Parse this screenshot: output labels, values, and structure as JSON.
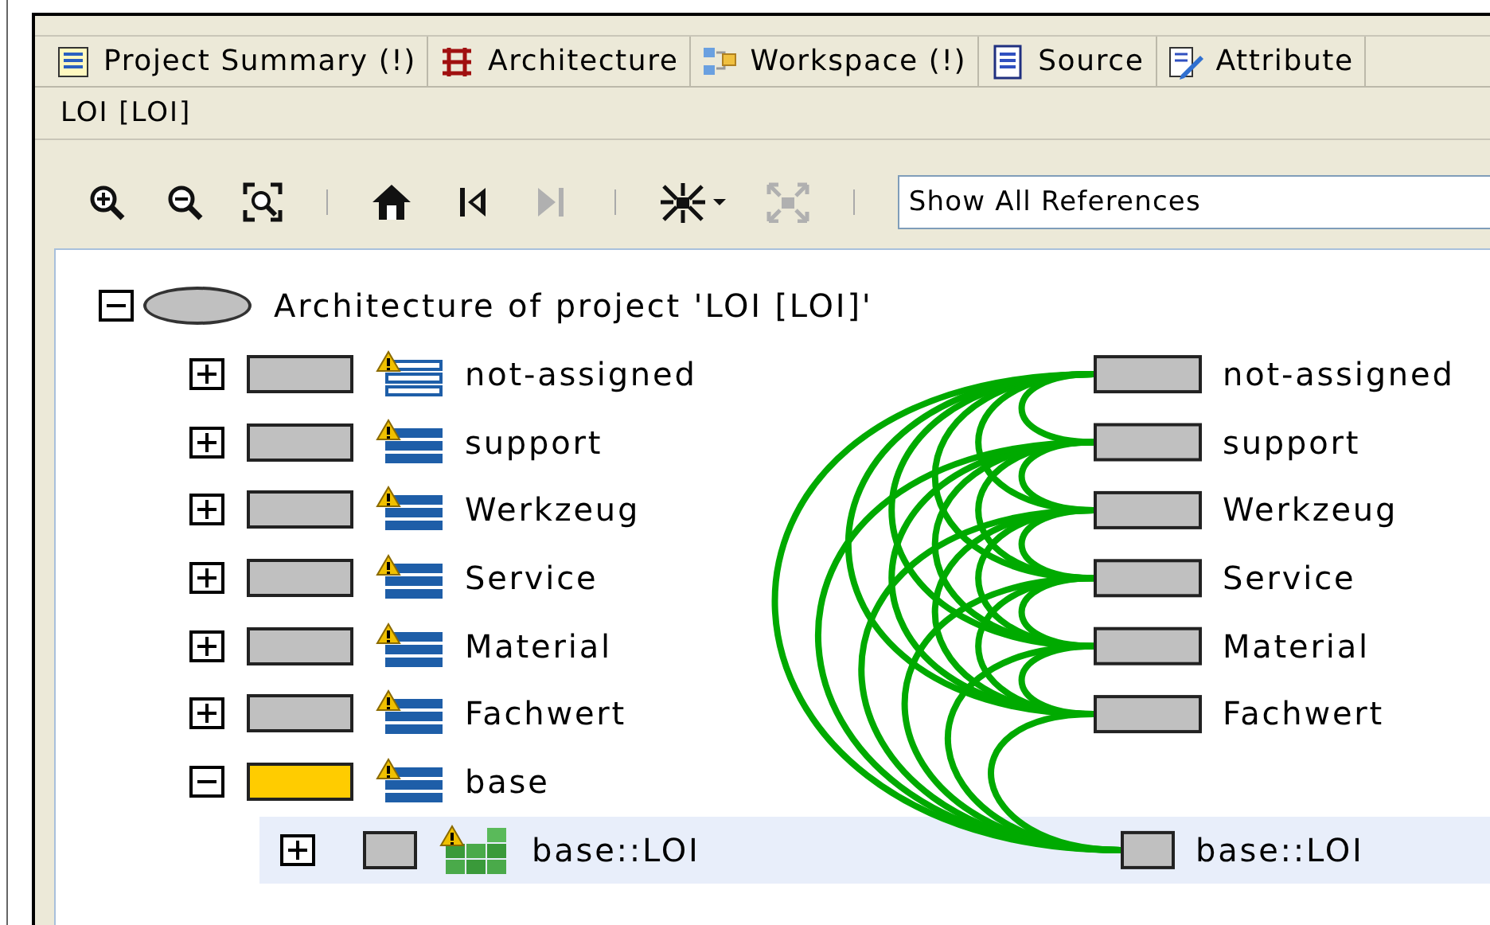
{
  "tabs": [
    {
      "label": "Project Summary (!)",
      "kind": "summary"
    },
    {
      "label": "Architecture",
      "kind": "architecture"
    },
    {
      "label": "Workspace (!)",
      "kind": "workspace"
    },
    {
      "label": "Source",
      "kind": "source"
    },
    {
      "label": "Attribute",
      "kind": "attribute"
    }
  ],
  "breadcrumb": "LOI [LOI]",
  "toolbar": [
    {
      "kind": "zoom-in",
      "disabled": false
    },
    {
      "kind": "zoom-out",
      "disabled": false
    },
    {
      "kind": "zoom-fit",
      "disabled": false
    },
    {
      "kind": "separator"
    },
    {
      "kind": "home",
      "disabled": false
    },
    {
      "kind": "first",
      "disabled": false
    },
    {
      "kind": "next",
      "disabled": true
    },
    {
      "kind": "separator"
    },
    {
      "kind": "layout",
      "disabled": false
    },
    {
      "kind": "expand",
      "disabled": true
    },
    {
      "kind": "separator"
    }
  ],
  "reference_filter": {
    "value": "Show All References"
  },
  "tree": {
    "label": "Architecture of project 'LOI [LOI]'",
    "expanded": true,
    "children": [
      {
        "label": "not-assigned",
        "kind": "empty-layer",
        "warning": true,
        "expanded": false,
        "color": "#c0c0c0",
        "selected": false,
        "graph_label": "not-assigned"
      },
      {
        "label": "support",
        "kind": "layer",
        "warning": true,
        "expanded": false,
        "color": "#c0c0c0",
        "selected": false,
        "graph_label": "support"
      },
      {
        "label": "Werkzeug",
        "kind": "layer",
        "warning": true,
        "expanded": false,
        "color": "#c0c0c0",
        "selected": false,
        "graph_label": "Werkzeug"
      },
      {
        "label": "Service",
        "kind": "layer",
        "warning": true,
        "expanded": false,
        "color": "#c0c0c0",
        "selected": false,
        "graph_label": "Service"
      },
      {
        "label": "Material",
        "kind": "layer",
        "warning": true,
        "expanded": false,
        "color": "#c0c0c0",
        "selected": false,
        "graph_label": "Material"
      },
      {
        "label": "Fachwert",
        "kind": "layer",
        "warning": true,
        "expanded": false,
        "color": "#c0c0c0",
        "selected": false,
        "graph_label": "Fachwert"
      },
      {
        "label": "base",
        "kind": "layer",
        "warning": true,
        "expanded": true,
        "color": "#ffcc00",
        "selected": false,
        "children": [
          {
            "label": "base::LOI",
            "kind": "subsystem",
            "warning": true,
            "expanded": false,
            "color": "#c0c0c0",
            "selected": true,
            "graph_label": "base::LOI"
          }
        ]
      }
    ]
  }
}
